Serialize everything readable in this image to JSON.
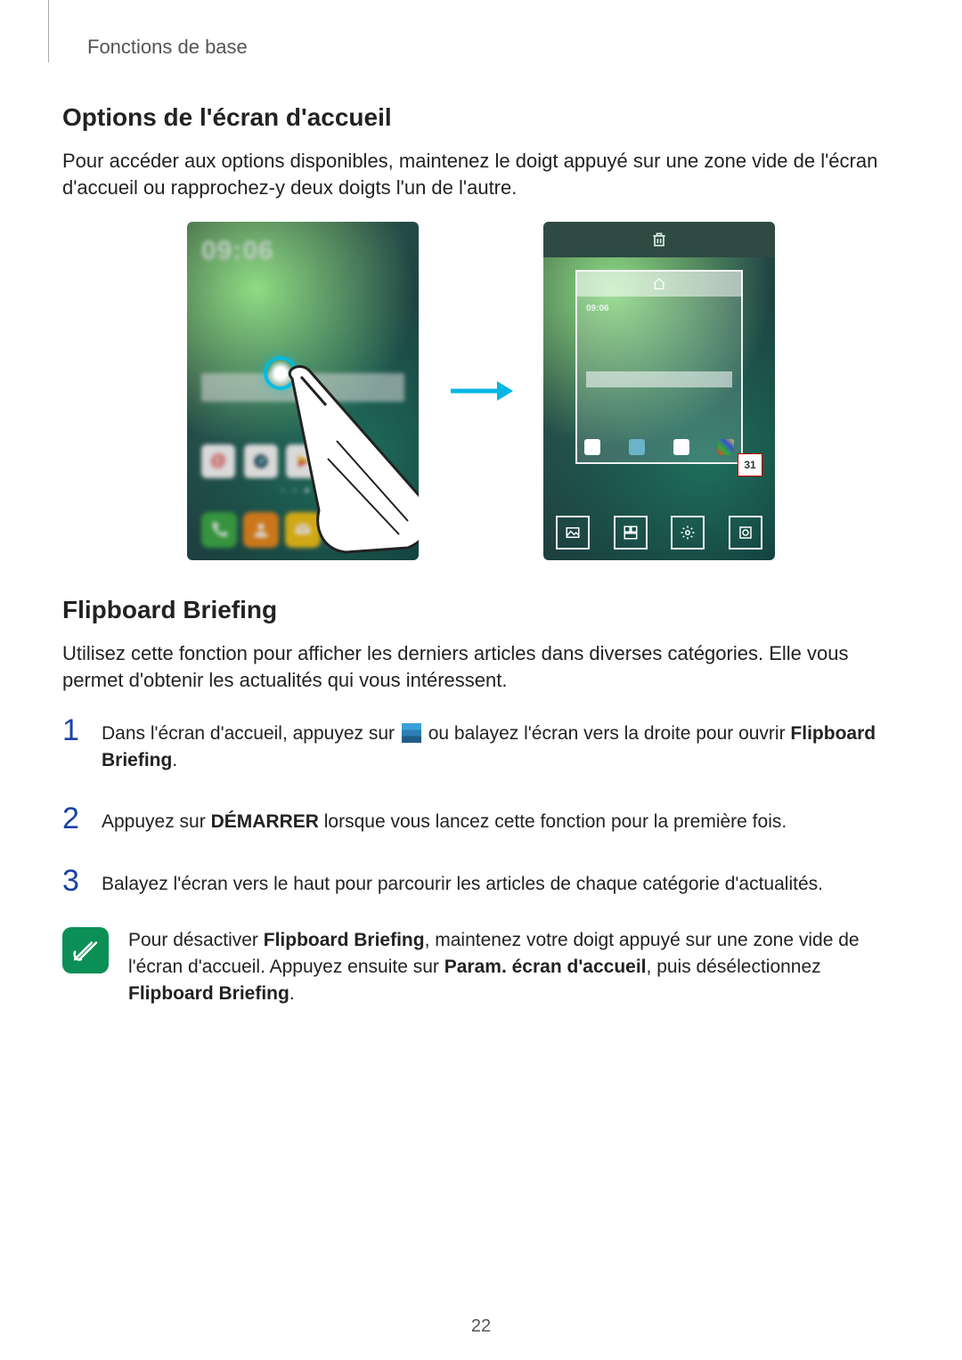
{
  "breadcrumb": "Fonctions de base",
  "section1_title": "Options de l'écran d'accueil",
  "section1_body": "Pour accéder aux options disponibles, maintenez le doigt appuyé sur une zone vide de l'écran d'accueil ou rapprochez-y deux doigts l'un de l'autre.",
  "phone_clock": "09:06",
  "calendar_day": "31",
  "section2_title": "Flipboard Briefing",
  "section2_body": "Utilisez cette fonction pour afficher les derniers articles dans diverses catégories. Elle vous permet d'obtenir les actualités qui vous intéressent.",
  "steps": {
    "s1_a": "Dans l'écran d'accueil, appuyez sur ",
    "s1_b": " ou balayez l'écran vers la droite pour ouvrir ",
    "s1_bold": "Flipboard Briefing",
    "s1_c": ".",
    "s2_a": "Appuyez sur ",
    "s2_bold": "DÉMARRER",
    "s2_b": " lorsque vous lancez cette fonction pour la première fois.",
    "s3": "Balayez l'écran vers le haut pour parcourir les articles de chaque catégorie d'actualités."
  },
  "note": {
    "a": "Pour désactiver ",
    "bold1": "Flipboard Briefing",
    "b": ", maintenez votre doigt appuyé sur une zone vide de l'écran d'accueil. Appuyez ensuite sur ",
    "bold2": "Param. écran d'accueil",
    "c": ", puis désélectionnez ",
    "bold3": "Flipboard Briefing",
    "d": "."
  },
  "page_number": "22"
}
